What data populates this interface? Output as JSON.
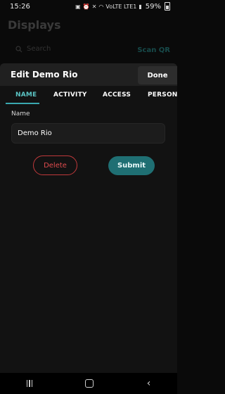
{
  "status": {
    "time": "15:26",
    "battery": "59%",
    "network": "VoLTE LTE1"
  },
  "background": {
    "title": "Displays",
    "search_placeholder": "Search",
    "scan_qr": "Scan QR"
  },
  "sheet": {
    "title": "Edit Demo Rio",
    "done_label": "Done",
    "tabs": [
      "NAME",
      "ACTIVITY",
      "ACCESS",
      "PERSONA"
    ],
    "active_tab": "NAME",
    "name_label": "Name",
    "name_value": "Demo Rio",
    "delete_label": "Delete",
    "submit_label": "Submit"
  },
  "colors": {
    "accent": "#3aa8b0",
    "danger": "#e14c4e",
    "submit_bg": "#1f6f73"
  }
}
